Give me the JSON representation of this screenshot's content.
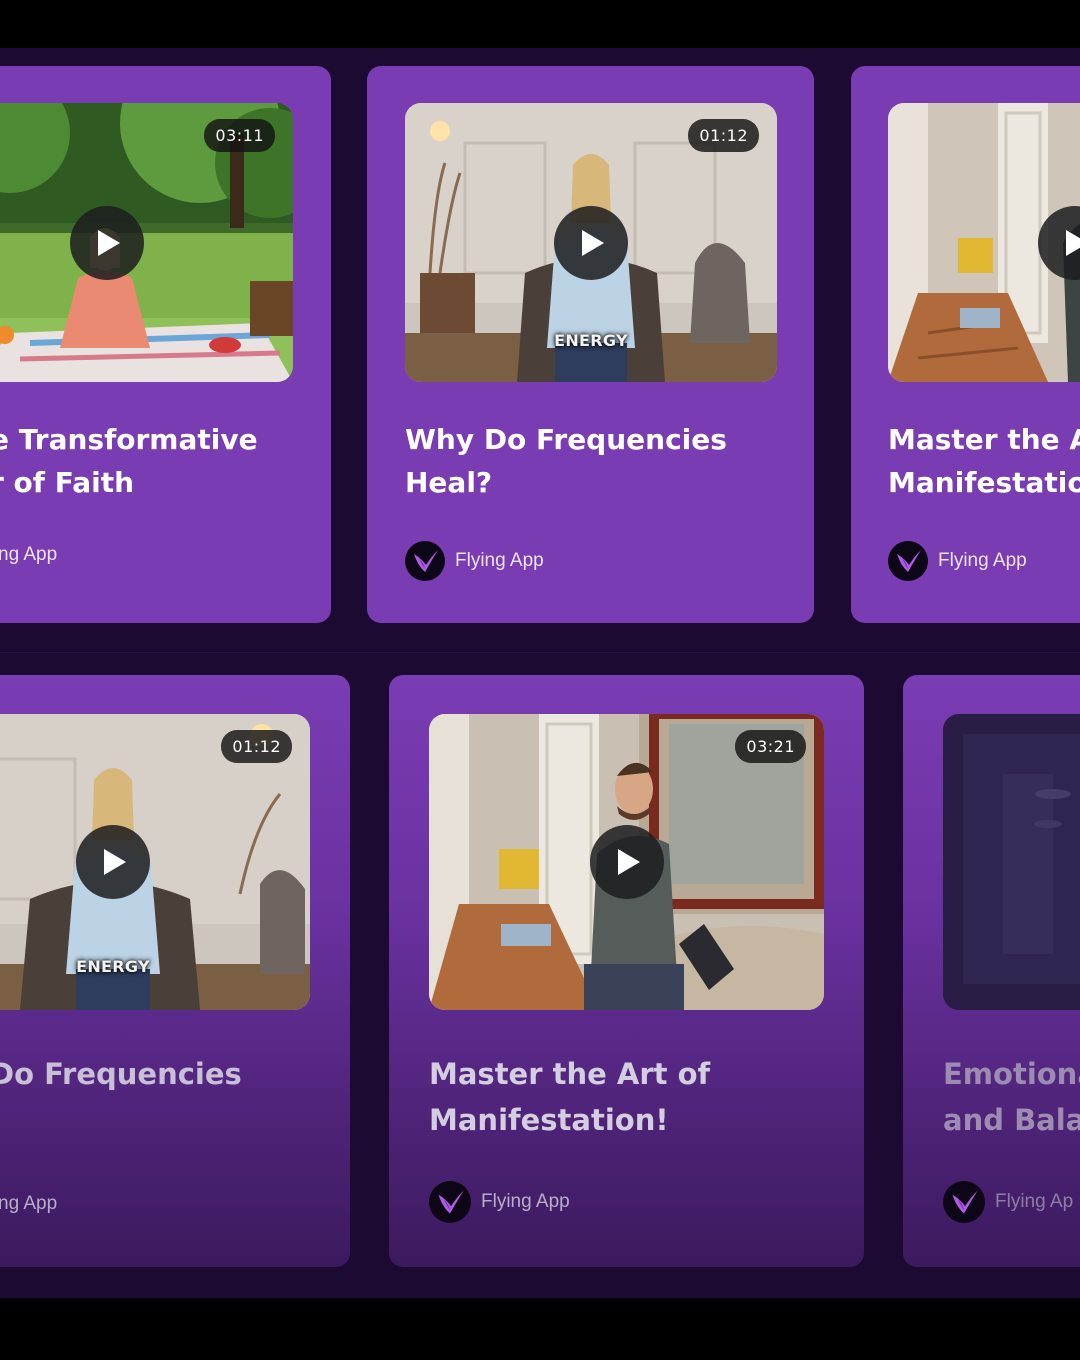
{
  "colors": {
    "card_purple": "#7a3cb3",
    "page_dark": "#1c0a33",
    "play_button": "#1c1c1e"
  },
  "row1": [
    {
      "duration": "03:11",
      "title_line1": "e Transformative",
      "title_line2": "r of Faith",
      "author": "ng App",
      "scene": "woman-picnic-park"
    },
    {
      "duration": "01:12",
      "title_line1": "Why Do Frequencies",
      "title_line2": "Heal?",
      "author": "Flying App",
      "caption": "ENERGY",
      "scene": "woman-armchair-room"
    },
    {
      "title_line1": "Master the Ar",
      "title_line2": "Manifestation",
      "author": "Flying App",
      "scene": "man-hallway-room"
    }
  ],
  "row2": [
    {
      "duration": "01:12",
      "title_line1": "Do Frequencies",
      "title_line2": "",
      "author": "ng App",
      "caption": "ENERGY",
      "scene": "woman-armchair-room"
    },
    {
      "duration": "03:21",
      "title_line1": "Master the Art of",
      "title_line2": "Manifestation!",
      "author": "Flying App",
      "scene": "man-sofa-room"
    },
    {
      "title_line1": "Emotiona",
      "title_line2": "and Bala",
      "author": "Flying Ap",
      "scene": "dark-corridor"
    }
  ]
}
